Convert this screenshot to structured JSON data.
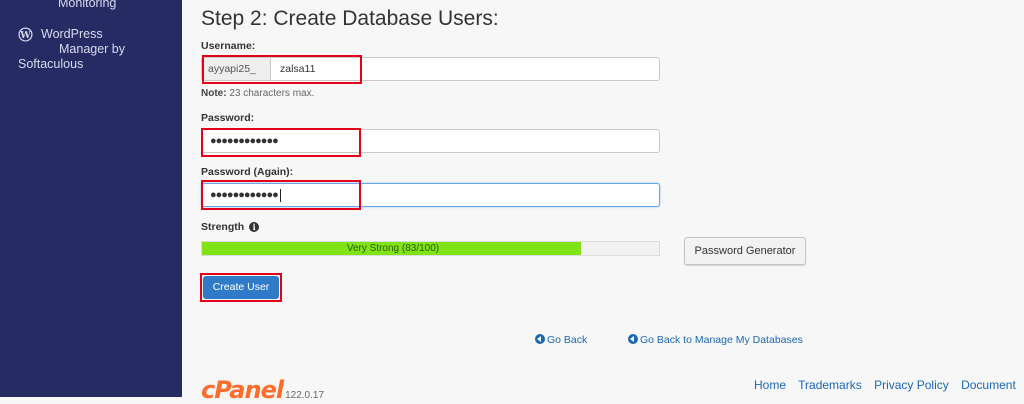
{
  "sidebar": {
    "items": [
      {
        "label": "Monitoring"
      },
      {
        "label_lines": [
          "WordPress",
          "Manager by",
          "Softaculous"
        ],
        "icon": "wordpress-icon"
      }
    ]
  },
  "main": {
    "title": "Step 2: Create Database Users:",
    "username": {
      "label": "Username:",
      "prefix": "ayyapi25_",
      "value": "zalsa11",
      "note_bold": "Note:",
      "note_text": " 23 characters max."
    },
    "password": {
      "label": "Password:",
      "masked_value": "●●●●●●●●●●●●"
    },
    "password_again": {
      "label": "Password (Again):",
      "masked_value": "●●●●●●●●●●●●"
    },
    "strength": {
      "label": "Strength",
      "info_icon": "info-circle-icon",
      "text": "Very Strong (83/100)",
      "score": 83,
      "meter_color": "#7fe317"
    },
    "password_generator_label": "Password Generator",
    "create_user_label": "Create User",
    "links": {
      "go_back": "Go Back",
      "go_back_manage": "Go Back to Manage My Databases"
    }
  },
  "footer": {
    "logo_text": "cPanel",
    "version": "122.0.17",
    "links": [
      "Home",
      "Trademarks",
      "Privacy Policy",
      "Document"
    ]
  },
  "colors": {
    "sidebar_bg": "#262b63",
    "accent_blue": "#2f7bc9",
    "highlight_red": "#e2001a",
    "brand_orange": "#ff6c2c"
  }
}
